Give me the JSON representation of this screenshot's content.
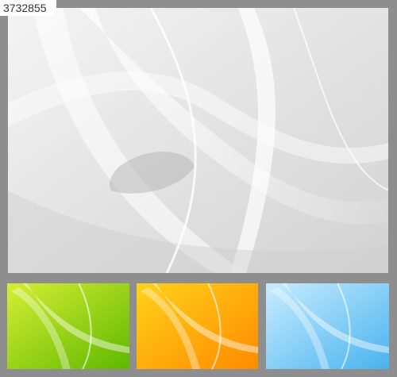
{
  "stock_id": "3732855",
  "watermark_text": "",
  "cards": {
    "main": {
      "name": "silver-wave-background",
      "colors": [
        "#fbfbfb",
        "#cfcfcf"
      ]
    },
    "green": {
      "name": "green-wave-background",
      "colors": [
        "#d6ee34",
        "#5fb800"
      ]
    },
    "orange": {
      "name": "orange-wave-background",
      "colors": [
        "#ffd21a",
        "#ff8a00"
      ]
    },
    "blue": {
      "name": "blue-wave-background",
      "colors": [
        "#c9ecff",
        "#48b3ee"
      ]
    }
  }
}
